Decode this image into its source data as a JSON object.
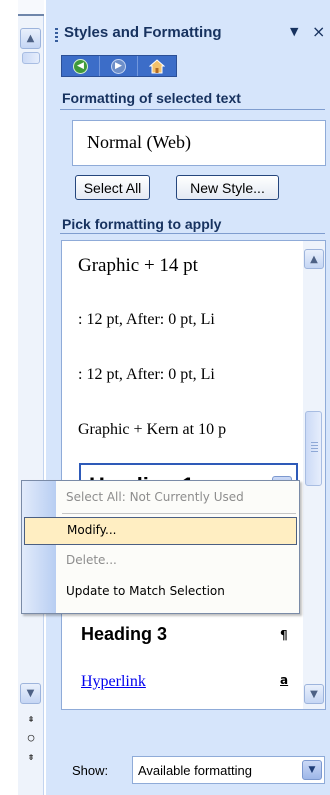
{
  "pane": {
    "title": "Styles and Formatting",
    "menu_arrow": "▼",
    "close": "×"
  },
  "nav": {
    "back_icon": "back-arrow-icon",
    "forward_icon": "forward-arrow-icon",
    "home_icon": "home-icon"
  },
  "formatting_selected": {
    "heading": "Formatting of selected text",
    "current_style": "Normal (Web)"
  },
  "buttons": {
    "select_all": "Select All",
    "new_style": "New Style..."
  },
  "pick": {
    "heading": "Pick formatting to apply",
    "items": [
      "Graphic + 14 pt",
      ":  12 pt, After:  0 pt, Li",
      ":  12 pt, After:  0 pt, Li",
      "Graphic + Kern at 10 p"
    ],
    "selected_item": "Heading 1",
    "heading3": "Heading 3",
    "heading3_mark": "¶",
    "hyperlink": "Hyperlink",
    "hyperlink_mark": "a"
  },
  "context_menu": {
    "select_all": "Select All: Not Currently Used",
    "modify": "Modify...",
    "delete": "Delete...",
    "update": "Update to Match Selection"
  },
  "show": {
    "label": "Show:",
    "value": "Available formatting"
  },
  "colors": {
    "pane_background": "#d6e5fb",
    "title_text": "#17325f",
    "nav_bar": "#3c6dc8",
    "menu_highlight": "#ffeec2",
    "hyperlink": "#0000ee"
  }
}
